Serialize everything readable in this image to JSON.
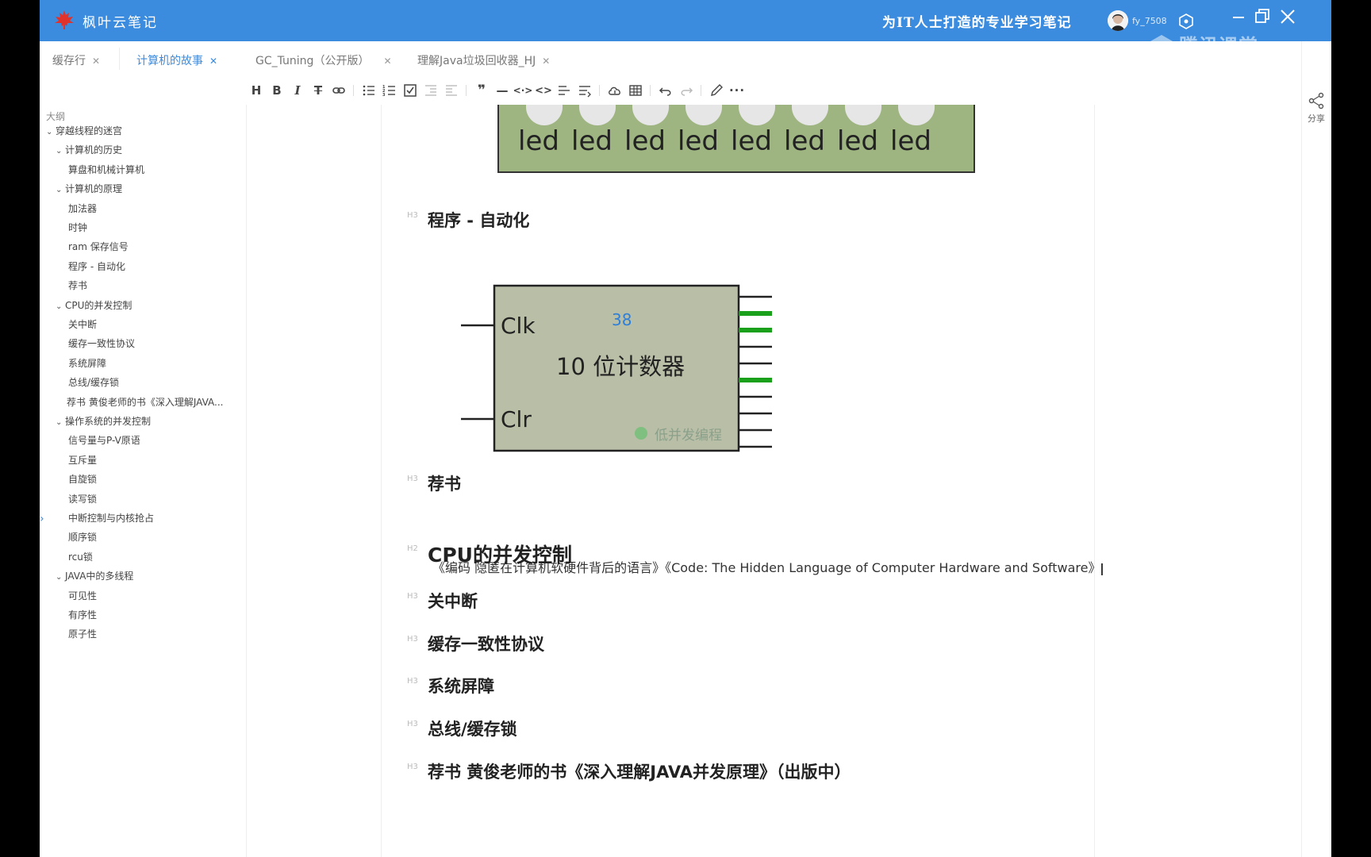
{
  "titlebar": {
    "app_name": "枫叶云笔记",
    "slogan": "为IT人士打造的专业学习笔记",
    "username": "fy_7508",
    "watermark": "腾讯课堂",
    "brand_color": "#3b8cdf"
  },
  "tabs": [
    {
      "label": "缓存行",
      "active": false
    },
    {
      "label": "计算机的故事",
      "active": true
    },
    {
      "label": "GC_Tuning（公开版）",
      "active": false
    },
    {
      "label": "理解Java垃圾回收器_HJ",
      "active": false
    }
  ],
  "toolbar": {
    "icons": [
      "heading-icon",
      "bold-icon",
      "italic-icon",
      "strikethrough-icon",
      "link-icon",
      "bullet-list-icon",
      "numbered-list-icon",
      "checklist-icon",
      "indent-icon",
      "outdent-icon",
      "quote-icon",
      "horizontal-rule-icon",
      "code-inline-icon",
      "code-block-icon",
      "align-icon",
      "format-icon",
      "cloud-upload-icon",
      "table-icon",
      "undo-icon",
      "redo-icon",
      "pen-icon",
      "more-icon"
    ]
  },
  "outline": {
    "title": "大纲",
    "items": [
      {
        "label": "穿越线程的迷宫",
        "level": 0,
        "expanded": true
      },
      {
        "label": "计算机的历史",
        "level": 1,
        "expanded": true
      },
      {
        "label": "算盘和机械计算机",
        "level": 2
      },
      {
        "label": "计算机的原理",
        "level": 1,
        "expanded": true
      },
      {
        "label": "加法器",
        "level": 2
      },
      {
        "label": "时钟",
        "level": 2
      },
      {
        "label": "ram 保存信号",
        "level": 2
      },
      {
        "label": "程序 - 自动化",
        "level": 2
      },
      {
        "label": "荐书",
        "level": 2
      },
      {
        "label": "CPU的并发控制",
        "level": 1,
        "expanded": true
      },
      {
        "label": "关中断",
        "level": 2
      },
      {
        "label": "缓存一致性协议",
        "level": 2
      },
      {
        "label": "系统屏障",
        "level": 2
      },
      {
        "label": "总线/缓存锁",
        "level": 2
      },
      {
        "label": "荐书 黄俊老师的书《深入理解JAVA...",
        "level": 2
      },
      {
        "label": "操作系统的并发控制",
        "level": 1,
        "expanded": true
      },
      {
        "label": "信号量与P-V原语",
        "level": 2
      },
      {
        "label": "互斥量",
        "level": 2
      },
      {
        "label": "自旋锁",
        "level": 2
      },
      {
        "label": "读写锁",
        "level": 2
      },
      {
        "label": "中断控制与内核抢占",
        "level": 2
      },
      {
        "label": "顺序锁",
        "level": 2
      },
      {
        "label": "rcu锁",
        "level": 2
      },
      {
        "label": "JAVA中的多线程",
        "level": 1,
        "expanded": true
      },
      {
        "label": "可见性",
        "level": 2
      },
      {
        "label": "有序性",
        "level": 2
      },
      {
        "label": "原子性",
        "level": 2
      }
    ]
  },
  "document": {
    "led_labels": [
      "led",
      "led",
      "led",
      "led",
      "led",
      "led",
      "led",
      "led"
    ],
    "h_program": "程序 - 自动化",
    "counter": {
      "clk": "Clk",
      "clr": "Clr",
      "value": "38",
      "title": "10 位计数器",
      "watermark": "低并发编程",
      "outputs_active": [
        false,
        true,
        true,
        false,
        false,
        true,
        false,
        false,
        false,
        false
      ]
    },
    "h_books": "荐书",
    "books_para": "《编码 隐匿在计算机软硬件背后的语言》《Code: The Hidden Language of Computer Hardware and Software》",
    "h_cpu": "CPU的并发控制",
    "h_interrupt": "关中断",
    "h_cache": "缓存一致性协议",
    "h_barrier": "系统屏障",
    "h_buslock": "总线/缓存锁",
    "h_book2": "荐书 黄俊老师的书《深入理解JAVA并发原理》（出版中）",
    "h3_mark": "H3",
    "h2_mark": "H2"
  },
  "share": {
    "label": "分享"
  }
}
